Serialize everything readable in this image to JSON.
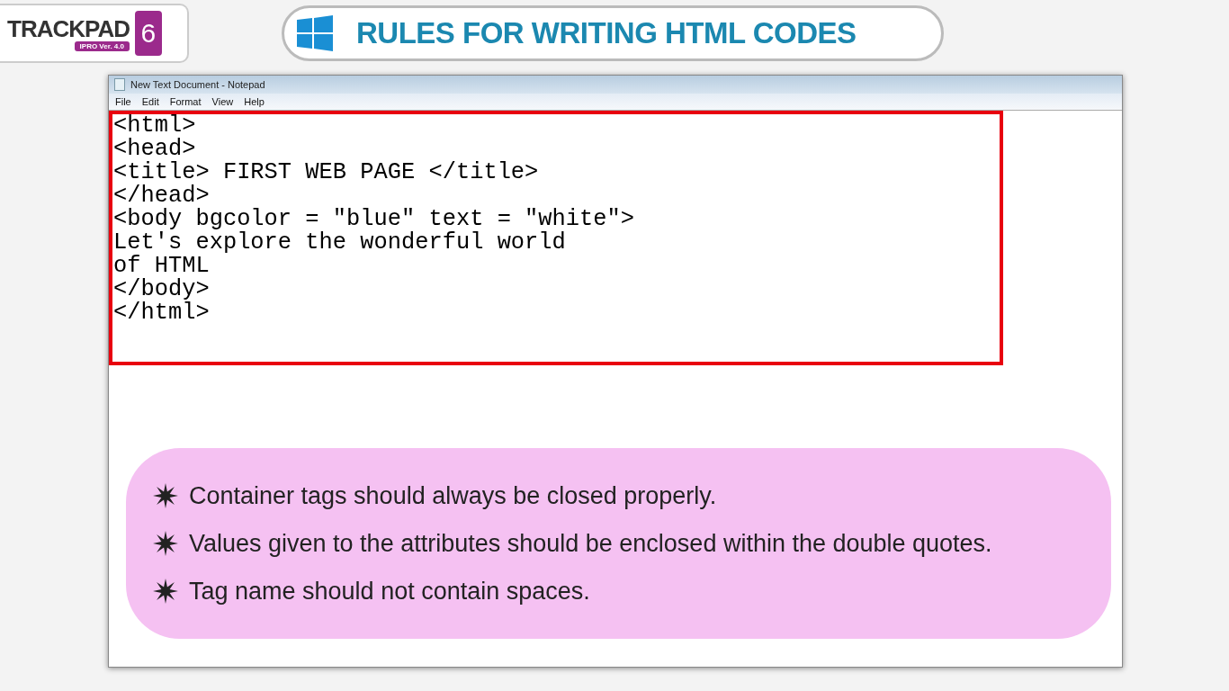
{
  "logo": {
    "brand": "TRACKPAD",
    "grade": "6",
    "version": "IPRO Ver. 4.0"
  },
  "heading": "RULES FOR WRITING HTML CODES",
  "notepad": {
    "title": "New Text Document - Notepad",
    "menu": [
      "File",
      "Edit",
      "Format",
      "View",
      "Help"
    ],
    "lines": [
      "<html>",
      "<head>",
      "<title> FIRST WEB PAGE </title>",
      "</head>",
      "<body bgcolor = \"blue\" text = \"white\">",
      "Let's explore the wonderful world",
      "of HTML",
      "</body>",
      "</html>"
    ]
  },
  "rules": [
    "Container tags should always be closed properly.",
    "Values given to the attributes should be enclosed within the double quotes.",
    "Tag name should not contain spaces."
  ]
}
